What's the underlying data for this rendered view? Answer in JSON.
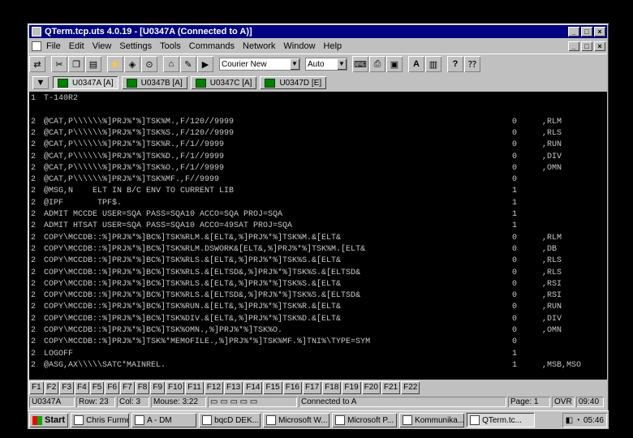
{
  "window": {
    "title": "QTerm.tcp.uts 4.0.19 - [U0347A (Connected to A)]"
  },
  "menu": [
    "File",
    "Edit",
    "View",
    "Settings",
    "Tools",
    "Commands",
    "Network",
    "Window",
    "Help"
  ],
  "toolbar": {
    "font_select": "Courier New",
    "size_select": "Auto"
  },
  "tabs": [
    "U0347A [A]",
    "U0347B [A]",
    "U0347C [A]",
    "U0347D [E]"
  ],
  "terminal": {
    "lines": [
      {
        "a": "1",
        "b": "T-140R2",
        "c": "",
        "d": ""
      },
      {
        "a": "",
        "b": "",
        "c": "",
        "d": ""
      },
      {
        "a": "2",
        "b": "@CAT,P\\\\\\\\\\\\%]PRJ%*%]TSK%M.,F/120//9999",
        "c": "0",
        "d": ",RLM"
      },
      {
        "a": "2",
        "b": "@CAT,P\\\\\\\\\\\\%]PRJ%*%]TSK%S.,F/120//9999",
        "c": "0",
        "d": ",RLS"
      },
      {
        "a": "2",
        "b": "@CAT,P\\\\\\\\\\\\%]PRJ%*%]TSK%R.,F/1//9999",
        "c": "0",
        "d": ",RUN"
      },
      {
        "a": "2",
        "b": "@CAT,P\\\\\\\\\\\\%]PRJ%*%]TSK%D.,F/1//9999",
        "c": "0",
        "d": ",DIV"
      },
      {
        "a": "2",
        "b": "@CAT,P\\\\\\\\\\\\%]PRJ%*%]TSK%O.,F/1//9999",
        "c": "0",
        "d": ",OMN"
      },
      {
        "a": "2",
        "b": "@CAT,P\\\\\\\\\\\\%]PRJ%*%]TSK%MF.,F//9999",
        "c": "0",
        "d": ""
      },
      {
        "a": "2",
        "b": "@MSG,N    ELT IN B/C ENV TO CURRENT LIB",
        "c": "1",
        "d": ""
      },
      {
        "a": "2",
        "b": "@IPF       TPF$.",
        "c": "1",
        "d": ""
      },
      {
        "a": "2",
        "b": "ADMIT MCCDE USER=SQA PASS=SQA10 ACCO=SQA PROJ=SQA",
        "c": "1",
        "d": ""
      },
      {
        "a": "2",
        "b": "ADMIT HTSAT USER=SQA PASS=SQA10 ACCO=49SAT PROJ=SQA",
        "c": "1",
        "d": ""
      },
      {
        "a": "2",
        "b": "COPY\\MCCDB::%]PRJ%*%]BC%]TSK%RLM.&[ELT&,%]PRJ%*%]TSK%M.&[ELT&",
        "c": "0",
        "d": ",RLM"
      },
      {
        "a": "2",
        "b": "COPY\\MCCDB::%]PRJ%*%]BC%]TSK%RLM.DSWORK&[ELT&,%]PRJ%*%]TSK%M.[ELT&",
        "c": "0",
        "d": ",DB"
      },
      {
        "a": "2",
        "b": "COPY\\MCCDB::%]PRJ%*%]BC%]TSK%RLS.&[ELT&,%]PRJ%*%]TSK%S.&[ELT&",
        "c": "0",
        "d": ",RLS"
      },
      {
        "a": "2",
        "b": "COPY\\MCCDB::%]PRJ%*%]BC%]TSK%RLS.&[ELTSD&,%]PRJ%*%]TSK%S.&[ELTSD&",
        "c": "0",
        "d": ",RLS"
      },
      {
        "a": "2",
        "b": "COPY\\MCCDB::%]PRJ%*%]BC%]TSK%RLS.&[ELT&,%]PRJ%*%]TSK%S.&[ELT&",
        "c": "0",
        "d": ",RSI"
      },
      {
        "a": "2",
        "b": "COPY\\MCCDB::%]PRJ%*%]BC%]TSK%RLS.&[ELTSD&,%]PRJ%*%]TSK%S.&[ELTSD&",
        "c": "0",
        "d": ",RSI"
      },
      {
        "a": "2",
        "b": "COPY\\MCCDB::%]PRJ%*%]BC%]TSK%RUN.&[ELT&,%]PRJ%*%]TSK%R.&[ELT&",
        "c": "0",
        "d": ",RUN"
      },
      {
        "a": "2",
        "b": "COPY\\MCCDB::%]PRJ%*%]BC%]TSK%DIV.&[ELT&,%]PRJ%*%]TSK%D.&[ELT&",
        "c": "0",
        "d": ",DIV"
      },
      {
        "a": "2",
        "b": "COPY\\MCCDB::%]PRJ%*%]BC%]TSK%OMN.,%]PRJ%*%]TSK%O.",
        "c": "0",
        "d": ",OMN"
      },
      {
        "a": "2",
        "b": "COPY\\MCCDB::%]PRJ%*%]TSK%*MEMOFILE.,%]PRJ%*%]TSK%MF.%]TNI%\\TYPE=SYM",
        "c": "0",
        "d": ""
      },
      {
        "a": "2",
        "b": "LOGOFF",
        "c": "1",
        "d": ""
      },
      {
        "a": "2",
        "b": "@ASG,AX\\\\\\\\\\SATC*MAINREL.",
        "c": "1",
        "d": ",MSB,MSO"
      }
    ]
  },
  "fkeys": [
    "F1",
    "F2",
    "F3",
    "F4",
    "F5",
    "F6",
    "F7",
    "F8",
    "F9",
    "F10",
    "F11",
    "F12",
    "F13",
    "F14",
    "F15",
    "F16",
    "F17",
    "F18",
    "F19",
    "F20",
    "F21",
    "F22"
  ],
  "status": {
    "session": "U0347A",
    "row": "Row: 23",
    "col": "Col: 3",
    "mouse": "Mouse: 3:22",
    "connection": "Connected to A",
    "page": "Page: 1",
    "ovr": "OVR",
    "time_small": "09:40"
  },
  "taskbar": {
    "start": "Start",
    "tasks": [
      "Chris Furme...",
      "A - DM",
      "bqcD DEK...",
      "Microsoft W...",
      "Microsoft P...",
      "Kommunika...",
      "QTerm.tc..."
    ],
    "clock": "05:46"
  }
}
